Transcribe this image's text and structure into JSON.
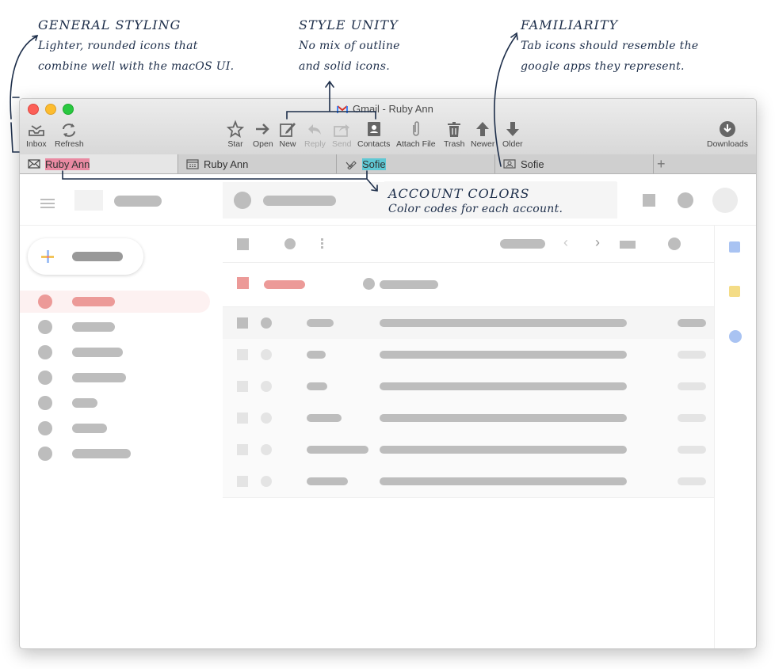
{
  "annotations": {
    "general": {
      "title": "GENERAL STYLING",
      "line1": "Lighter, rounded icons that",
      "line2": "combine well with the macOS UI."
    },
    "unity": {
      "title": "STYLE UNITY",
      "line1": "No mix of outline",
      "line2": "and solid icons."
    },
    "familiarity": {
      "title": "FAMILIARITY",
      "line1": "Tab icons should resemble the",
      "line2": "google apps they represent."
    },
    "colors": {
      "title": "ACCOUNT COLORS",
      "line1": "Color codes for each account."
    }
  },
  "window": {
    "title": "Gmail - Ruby Ann"
  },
  "toolbar": {
    "inbox": "Inbox",
    "refresh": "Refresh",
    "star": "Star",
    "open": "Open",
    "new": "New",
    "reply": "Reply",
    "send": "Send",
    "contacts": "Contacts",
    "attach": "Attach File",
    "trash": "Trash",
    "newer": "Newer",
    "older": "Older",
    "downloads": "Downloads"
  },
  "tabs": [
    {
      "label": "Ruby Ann",
      "icon": "mail-icon",
      "color": "#e98aa2"
    },
    {
      "label": "Ruby Ann",
      "icon": "calendar-icon"
    },
    {
      "label": "Sofie",
      "icon": "tasks-icon",
      "color": "#5fc8d4"
    },
    {
      "label": "Sofie",
      "icon": "contact-card-icon"
    }
  ],
  "colors": {
    "red": "#e98a88",
    "blue": "#a9c3f2",
    "yellow": "#f4dc86"
  }
}
